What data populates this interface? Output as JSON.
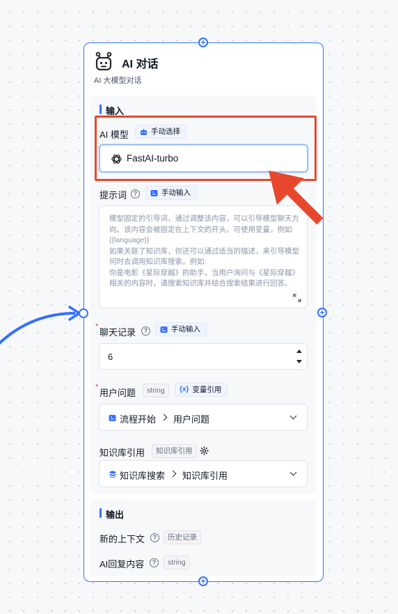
{
  "node": {
    "title": "AI 对话",
    "subtitle": "AI 大模型对话"
  },
  "input_section": {
    "title": "输入",
    "ai_model": {
      "label": "AI 模型",
      "mode": "手动选择",
      "value": "FastAI-turbo"
    },
    "prompt": {
      "label": "提示词",
      "mode": "手动输入",
      "placeholder": "模型固定的引导词，通过调整该内容，可以引导模型聊天方向。该内容会被固定在上下文的开头。可使用变量，例如 {{language}}\n如果关联了知识库，你还可以通过适当的描述，来引导模型何时去调用知识库搜索。例如:\n你是电影《星际穿越》的助手，当用户询问与《星际穿越》相关的内容时，请搜索知识库并结合搜索结果进行回答。"
    },
    "history": {
      "label": "聊天记录",
      "mode": "手动输入",
      "value": "6"
    },
    "user_question": {
      "label": "用户问题",
      "type_tag": "string",
      "mode": "变量引用",
      "source": "流程开始",
      "field": "用户问题"
    },
    "knowledge": {
      "label": "知识库引用",
      "type_tag": "知识库引用",
      "source": "知识库搜索",
      "field": "知识库引用"
    }
  },
  "output_section": {
    "title": "输出",
    "context": {
      "label": "新的上下文",
      "type_tag": "历史记录"
    },
    "reply": {
      "label": "AI回复内容",
      "type_tag": "string"
    }
  },
  "icons": {
    "robot": "robot-icon",
    "openai": "openai-icon",
    "help": "help-circle-icon",
    "gear": "gear-icon",
    "expand": "expand-icon"
  },
  "colors": {
    "accent": "#3370ff",
    "highlight": "#e8472e",
    "required": "#e53e3e"
  }
}
